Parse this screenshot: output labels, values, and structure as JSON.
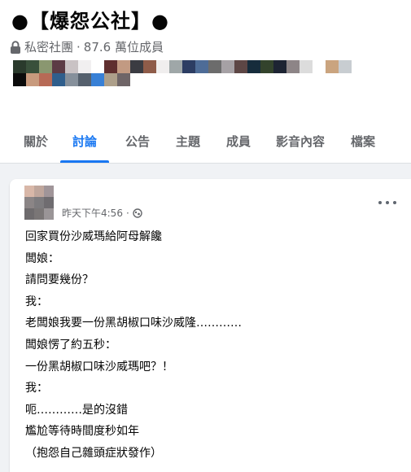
{
  "group": {
    "title": "●【爆怨公社】●",
    "privacy": "私密社團",
    "separator": "·",
    "members": "87.6 萬位成員"
  },
  "colors": {
    "accent": "#1877f2",
    "text": "#050505",
    "secondary": "#65676b"
  },
  "icons": {
    "privacy": "lock-icon",
    "timestamp": "globe-icon",
    "more": "more-options-icon"
  },
  "member_avatars": [
    "#2a3a2c",
    "#39503b",
    "#8a9770",
    "#5c3b45",
    "#c9c2c4",
    "#f1eff0",
    "#ffffff",
    "#5f2f2f",
    "#c29a82",
    "#3b3c42",
    "#8f5c49",
    "#f0eeee",
    "#9fa7a8",
    "#2c3d63",
    "#4e6c97",
    "#6c6c6c",
    "#a6a1a5",
    "#5d4645",
    "#162c3c",
    "#33432c",
    "#1d2433",
    "#8d8587",
    "#dcdcdc",
    "#ffffff",
    "#caa47f",
    "#c8cdd1",
    "#0b0b0b",
    "#c89a7d",
    "#b76a56",
    "#2f5e8c",
    "#86909b",
    "#55606d",
    "#3880d6",
    "#ad9f8a",
    "#6f6567"
  ],
  "tabs": [
    {
      "label": "關於",
      "active": false
    },
    {
      "label": "討論",
      "active": true
    },
    {
      "label": "公告",
      "active": false
    },
    {
      "label": "主題",
      "active": false
    },
    {
      "label": "成員",
      "active": false
    },
    {
      "label": "影音內容",
      "active": false
    },
    {
      "label": "檔案",
      "active": false
    }
  ],
  "post": {
    "timestamp": "昨天下午4:56",
    "separator": "·",
    "lines": [
      "回家買份沙威瑪給阿母解饞",
      "闆娘：",
      "請問要幾份？",
      "我：",
      "老闆娘我要一份黑胡椒口味沙威隆…………",
      "闆娘愣了約五秒：",
      "一份黑胡椒口味沙威瑪吧？！",
      "我：",
      "呃…………是的沒錯",
      "尷尬等待時間度秒如年",
      "（抱怨自己雜頭症狀發作）"
    ]
  }
}
